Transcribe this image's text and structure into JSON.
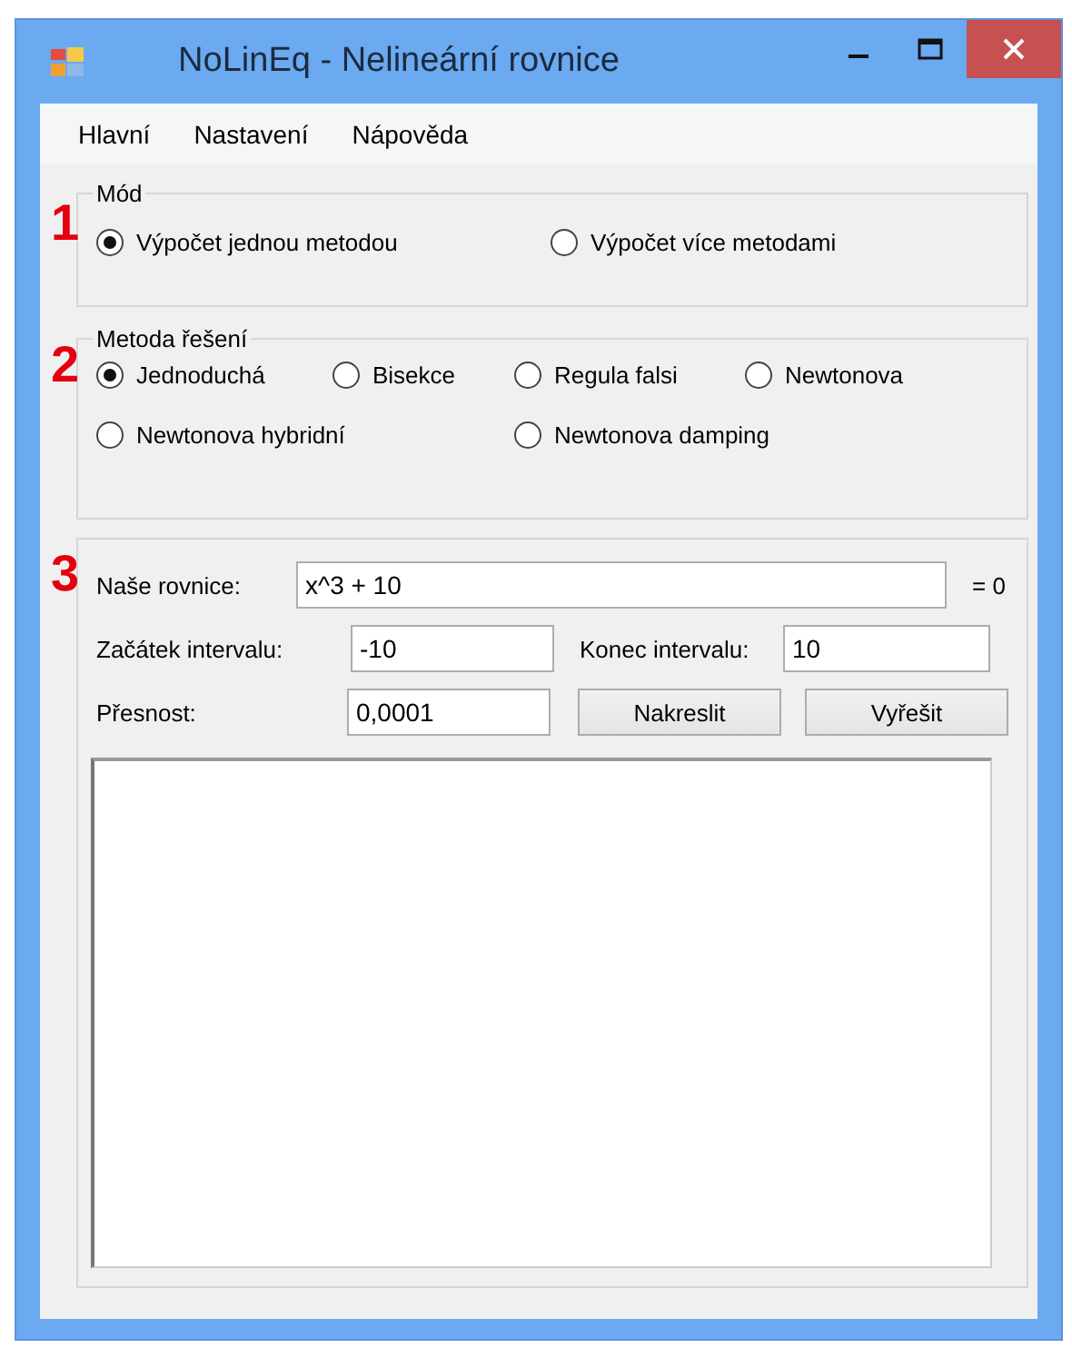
{
  "window": {
    "title": "NoLinEq - Nelineární rovnice"
  },
  "menu": [
    "Hlavní",
    "Nastavení",
    "Nápověda"
  ],
  "mode_group": {
    "marker": "1",
    "title": "Mód",
    "options": [
      {
        "label": "Výpočet jednou metodou",
        "selected": true
      },
      {
        "label": "Výpočet více metodami",
        "selected": false
      }
    ]
  },
  "method_group": {
    "marker": "2",
    "title": "Metoda řešení",
    "options": [
      {
        "label": "Jednoduchá",
        "selected": true
      },
      {
        "label": "Bisekce",
        "selected": false
      },
      {
        "label": "Regula falsi",
        "selected": false
      },
      {
        "label": "Newtonova",
        "selected": false
      },
      {
        "label": "Newtonova hybridní",
        "selected": false
      },
      {
        "label": "Newtonova damping",
        "selected": false
      }
    ]
  },
  "equation_group": {
    "marker": "3",
    "equation": {
      "label": "Naše rovnice:",
      "value": "x^3 + 10",
      "suffix": "= 0"
    },
    "interval_start": {
      "label": "Začátek intervalu:",
      "value": "-10"
    },
    "interval_end": {
      "label": "Konec intervalu:",
      "value": "10"
    },
    "precision": {
      "label": "Přesnost:",
      "value": "0,0001"
    },
    "buttons": [
      "Nakreslit",
      "Vyřešit"
    ]
  }
}
